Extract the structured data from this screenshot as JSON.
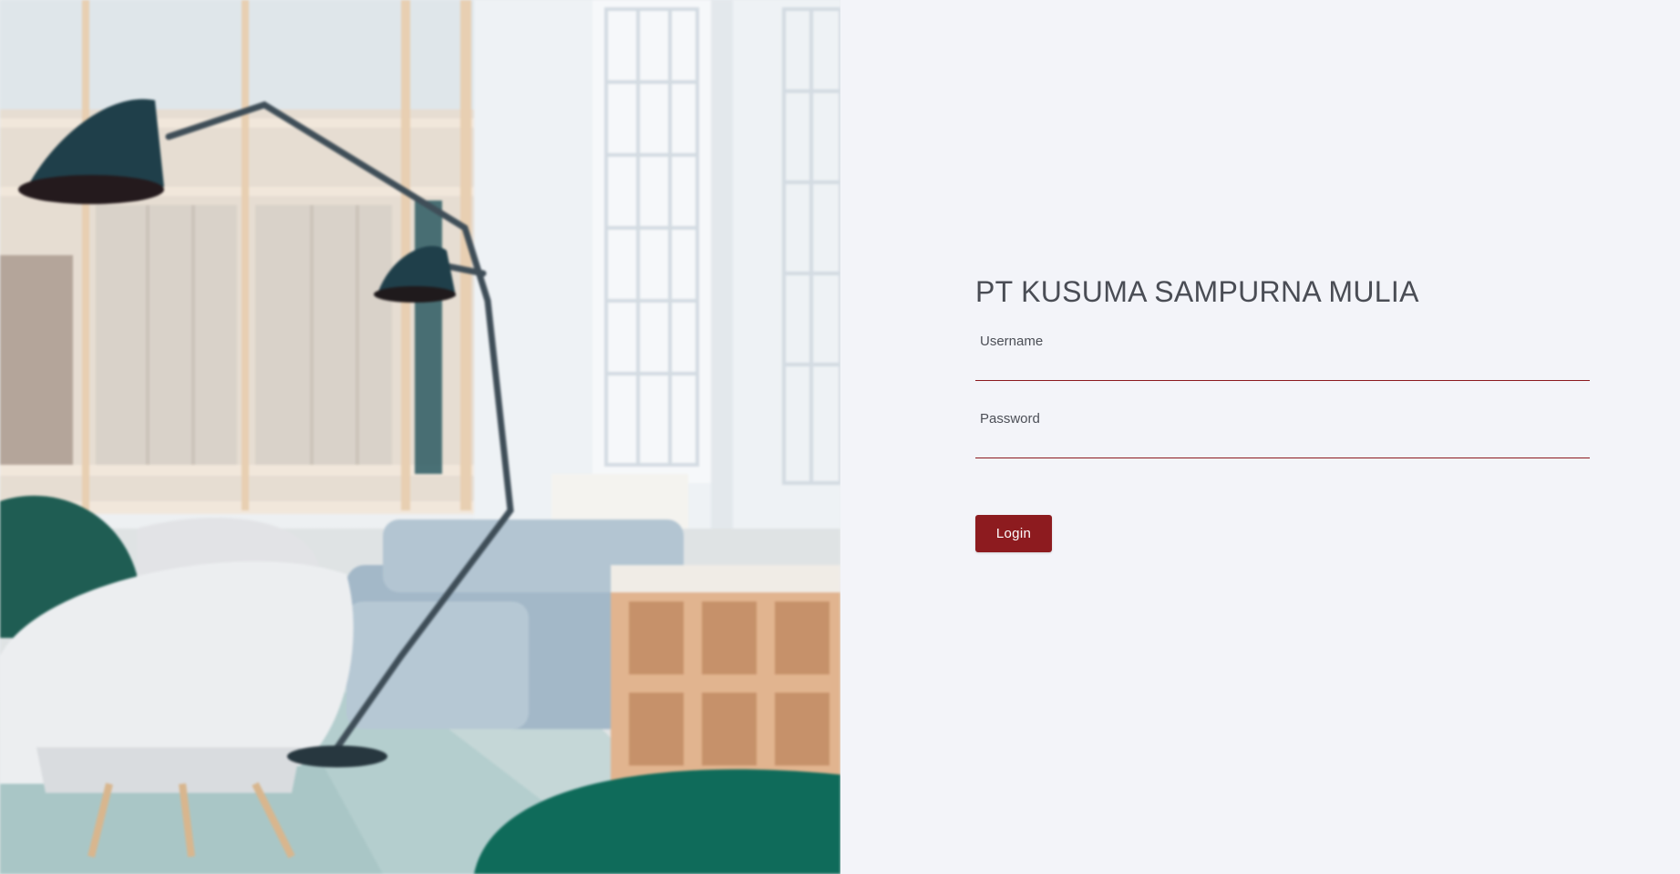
{
  "brand": {
    "company_name": "PT KUSUMA SAMPURNA MULIA",
    "accent_color": "#8d1b1f",
    "background_color": "#f3f4f9"
  },
  "hero": {
    "image_description": "interior-photo"
  },
  "form": {
    "username": {
      "label": "Username",
      "value": "",
      "placeholder": ""
    },
    "password": {
      "label": "Password",
      "value": "",
      "placeholder": ""
    },
    "login_label": "Login"
  }
}
